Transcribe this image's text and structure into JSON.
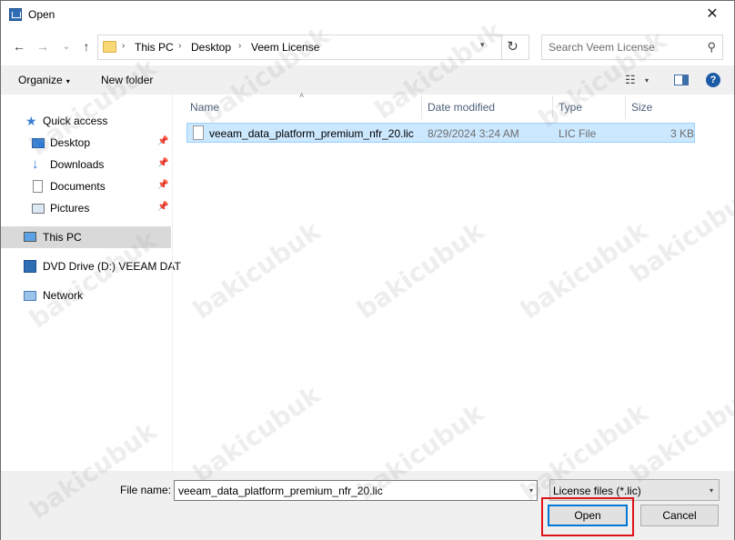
{
  "window": {
    "title": "Open",
    "close_glyph": "✕"
  },
  "nav": {
    "back_glyph": "←",
    "forward_glyph": "→",
    "recent_glyph": "⌄",
    "up_glyph": "↑",
    "breadcrumb": [
      "This PC",
      "Desktop",
      "Veem License"
    ],
    "separator": "›",
    "refresh_glyph": "↻",
    "search_placeholder": "Search Veem License",
    "search_glyph": "⚲"
  },
  "cmdbar": {
    "organize": "Organize",
    "new_folder": "New folder",
    "dropdown_glyph": "▾",
    "view_glyph": "☷",
    "help_glyph": "?"
  },
  "navpane": {
    "quick_access": "Quick access",
    "items": [
      {
        "label": "Desktop",
        "pinned": true
      },
      {
        "label": "Downloads",
        "pinned": true
      },
      {
        "label": "Documents",
        "pinned": true
      },
      {
        "label": "Pictures",
        "pinned": true
      }
    ],
    "pin_glyph": "📌",
    "this_pc": "This PC",
    "dvd": "DVD Drive (D:) VEEAM DAT",
    "network": "Network"
  },
  "list": {
    "columns": {
      "name": "Name",
      "date": "Date modified",
      "type": "Type",
      "size": "Size"
    },
    "sort_glyph": "˄",
    "files": [
      {
        "name": "veeam_data_platform_premium_nfr_20.lic",
        "date": "8/29/2024 3:24 AM",
        "type": "LIC File",
        "size": "3 KB"
      }
    ]
  },
  "bottom": {
    "file_name_label": "File name:",
    "file_name_value": "veeam_data_platform_premium_nfr_20.lic",
    "filter": "License files (*.lic)",
    "open": "Open",
    "cancel": "Cancel"
  },
  "watermark": "bakicubuk",
  "colors": {
    "selection": "#cce8ff",
    "highlight_box": "#e1141d",
    "accent": "#0078d7"
  }
}
